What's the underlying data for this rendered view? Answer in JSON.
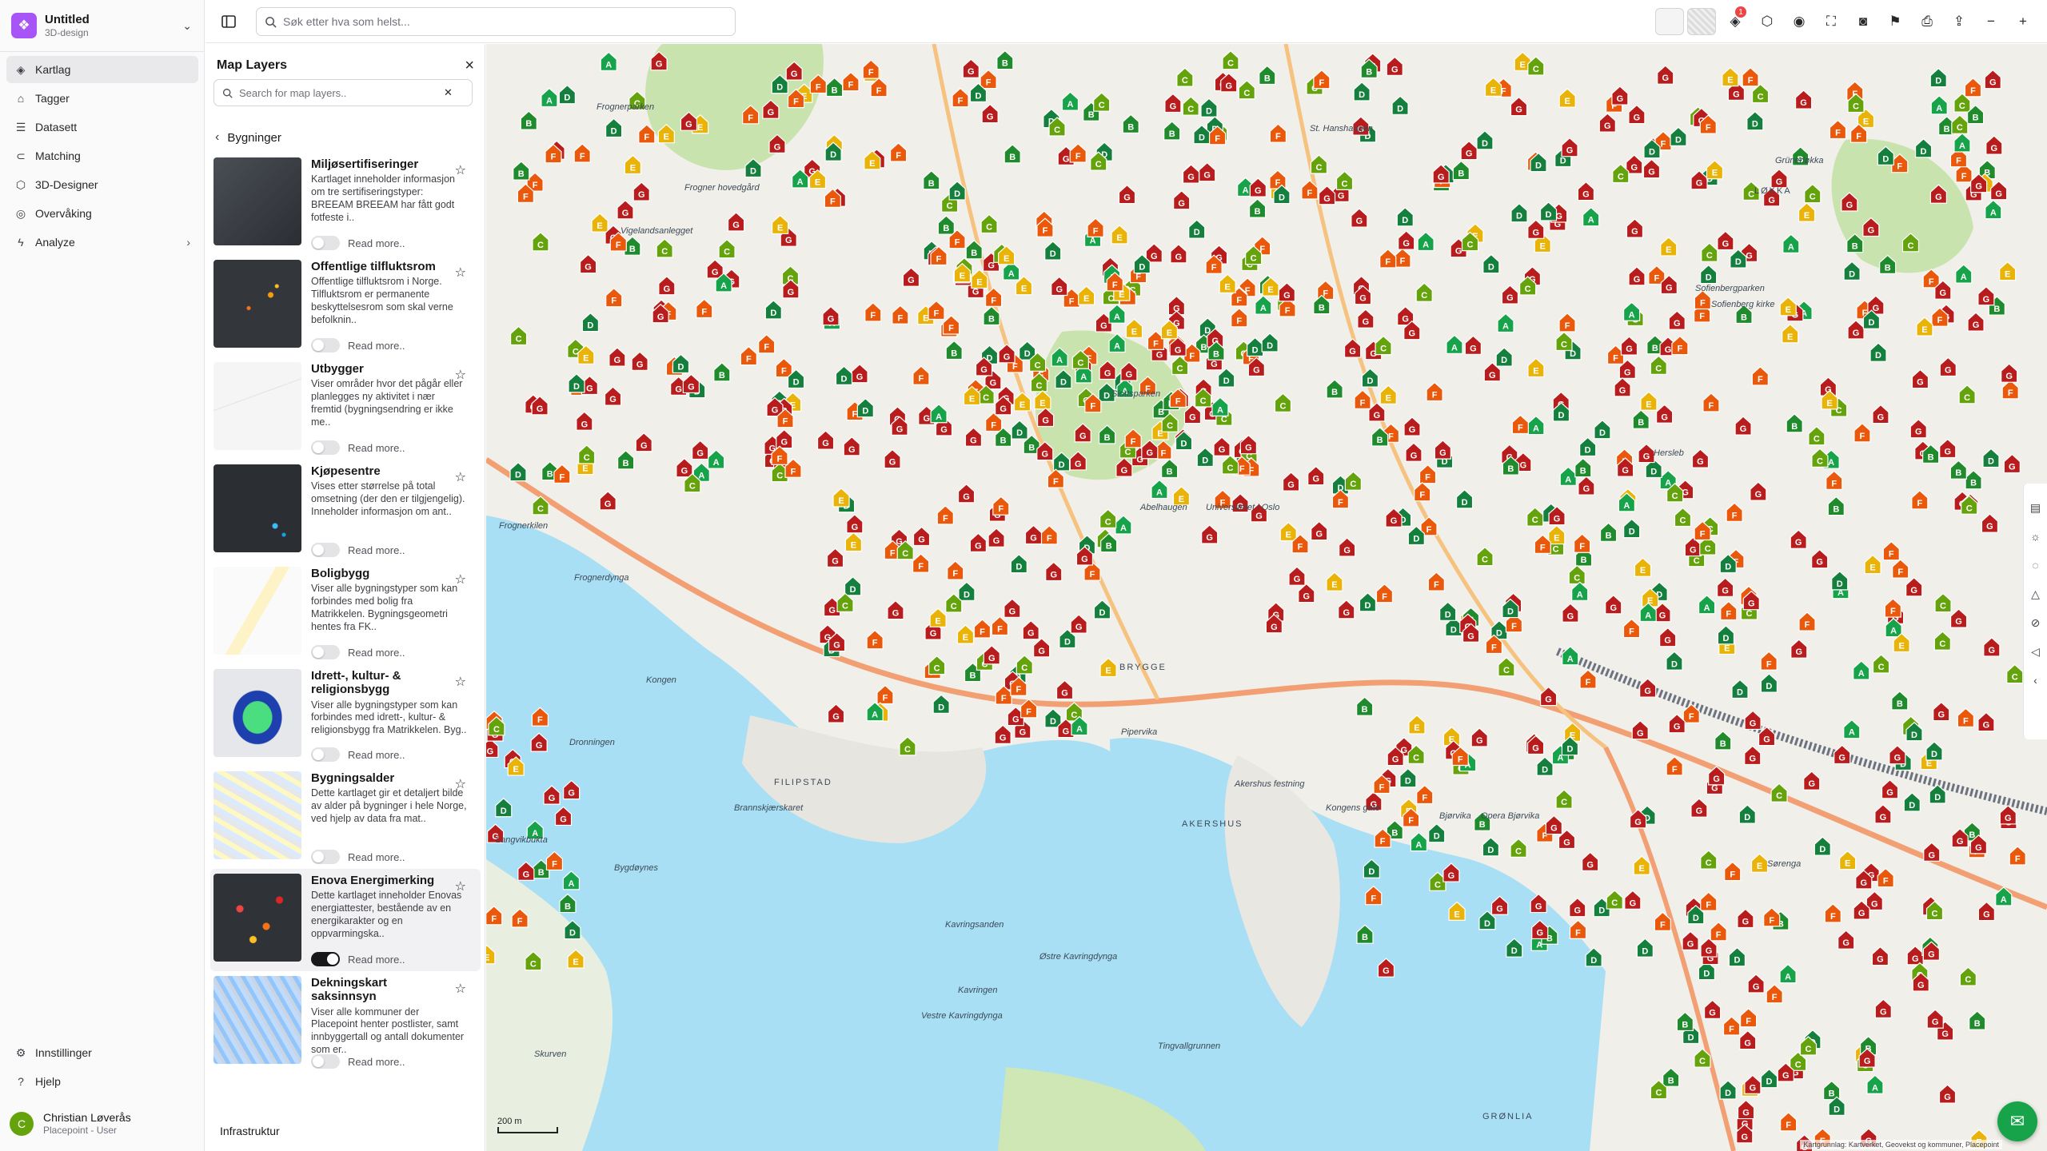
{
  "app": {
    "project_name": "Untitled",
    "project_type": "3D-design"
  },
  "sidebar": {
    "items": [
      {
        "label": "Kartlag",
        "icon": "layers-icon",
        "active": true
      },
      {
        "label": "Tagger",
        "icon": "tag-icon"
      },
      {
        "label": "Datasett",
        "icon": "list-icon"
      },
      {
        "label": "Matching",
        "icon": "link-icon"
      },
      {
        "label": "3D-Designer",
        "icon": "cube-icon"
      },
      {
        "label": "Overvåking",
        "icon": "radar-icon"
      },
      {
        "label": "Analyze",
        "icon": "bolt-icon",
        "has_submenu": true
      }
    ],
    "bottom_items": [
      {
        "label": "Innstillinger",
        "icon": "gear-icon"
      },
      {
        "label": "Hjelp",
        "icon": "help-icon"
      }
    ],
    "user": {
      "initial": "C",
      "name": "Christian Løverås",
      "role": "Placepoint - User"
    }
  },
  "topbar": {
    "search_placeholder": "Søk etter hva som helst...",
    "notification_count": "1"
  },
  "layers_panel": {
    "title": "Map Layers",
    "search_placeholder": "Search for map layers..",
    "breadcrumb": "Bygninger",
    "read_more": "Read more..",
    "next_section": "Infrastruktur",
    "layers": [
      {
        "title": "Miljøsertifiseringer",
        "desc": "Kartlaget inneholder informasjon om tre sertifiseringstyper: BREEAM BREEAM har fått godt fotfeste i..",
        "enabled": false
      },
      {
        "title": "Offentlige tilfluktsrom",
        "desc": "Offentlige tilfluktsrom i Norge. Tilfluktsrom er permanente beskyttelsesrom som skal verne befolknin..",
        "enabled": false
      },
      {
        "title": "Utbygger",
        "desc": "Viser områder hvor det pågår eller planlegges ny aktivitet i nær fremtid (bygningsendring er ikke me..",
        "enabled": false
      },
      {
        "title": "Kjøpesentre",
        "desc": "Vises etter størrelse på total omsetning (der den er tilgjengelig). Inneholder informasjon om ant..",
        "enabled": false
      },
      {
        "title": "Boligbygg",
        "desc": "Viser alle bygningstyper som kan forbindes med bolig fra Matrikkelen. Bygningsgeometri hentes fra FK..",
        "enabled": false
      },
      {
        "title": "Idrett-, kultur- & religionsbygg",
        "desc": "Viser alle bygningstyper som kan forbindes med idrett-, kultur- & religionsbygg fra Matrikkelen. Byg..",
        "enabled": false
      },
      {
        "title": "Bygningsalder",
        "desc": "Dette kartlaget gir et detaljert bilde av alder på bygninger i hele Norge, ved hjelp av data fra mat..",
        "enabled": false
      },
      {
        "title": "Enova Energimerking",
        "desc": "Dette kartlaget inneholder Enovas energiattester, bestående av en energikarakter og en oppvarmingska..",
        "enabled": true
      },
      {
        "title": "Dekningskart saksinnsyn",
        "desc": "Viser alle kommuner der Placepoint henter postlister, samt innbyggertall og antall dokumenter som er..",
        "enabled": false
      }
    ]
  },
  "map": {
    "scale_label": "200 m",
    "attribution": "Kartgrunnlag: Kartverket, Geovekst og kommuner, Placepoint",
    "labels": [
      "Frognerparken",
      "Frogner hovedgård",
      "Vigelandsanlegget",
      "Frognerkilen",
      "Frognerdynga",
      "Kongen",
      "Dronningen",
      "Bygdøynes",
      "Langvikbukta",
      "FILIPSTAD",
      "Brannskjærskaret",
      "Pipervika",
      "AKERSHUS",
      "Akershus festning",
      "Kongens gate",
      "Bjørvika",
      "Kavringsanden",
      "Østre Kavringdynga",
      "Vestre Kavringdynga",
      "Kavringen",
      "Skurven",
      "Tingvallgrunnen",
      "GRØNLIA",
      "Slottsparken",
      "BRYGGE",
      "Sofienbergparken",
      "Sofienberg kirke",
      "LØKKA",
      "Grünerløkka",
      "St. Hanshaugen",
      "Abelhaugen",
      "Universitetet i Oslo",
      "Hersleb",
      "Sørenga",
      "Opera Bjørvika"
    ],
    "energy_colors": {
      "A": "#16a34a",
      "B": "#1f8b2c",
      "C": "#65a30d",
      "D": "#15803d",
      "E": "#eab308",
      "F": "#ea580c",
      "G": "#b91c1c"
    }
  }
}
